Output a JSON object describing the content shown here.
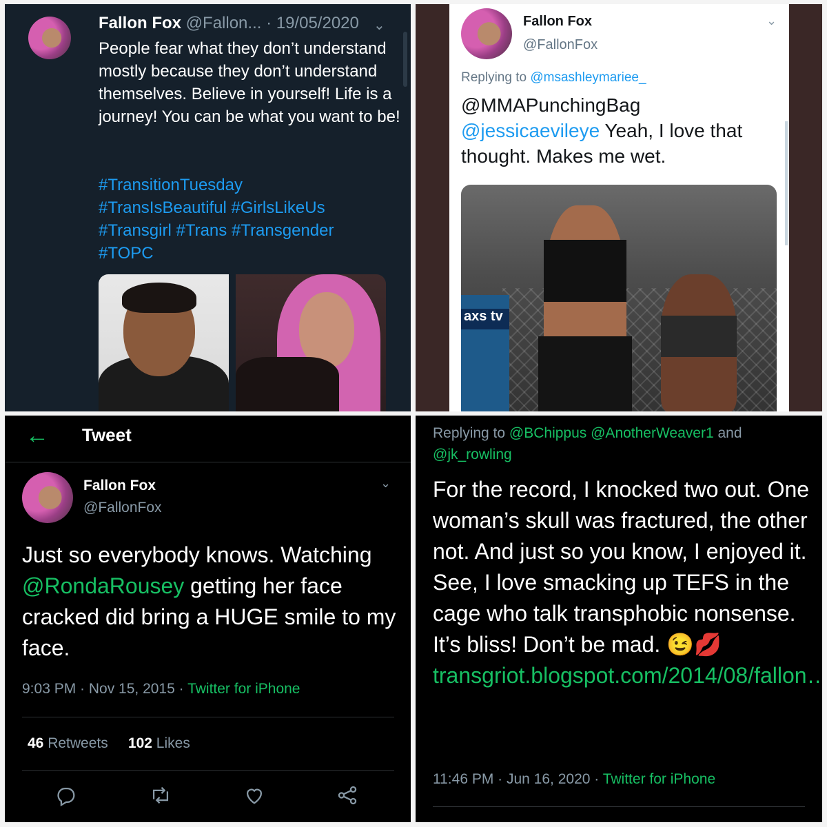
{
  "panel1": {
    "name": "Fallon Fox",
    "handle": "@Fallon...",
    "date": "· 19/05/2020",
    "body": "People fear what they don’t understand mostly because they don’t understand themselves. Believe in yourself! Life is a journey! You can be what you want to be!",
    "hashtags_line1": "#TransitionTuesday",
    "hashtags_line2": "#TransIsBeautiful #GirlsLikeUs",
    "hashtags_line3": "#Transgirl #Trans #Transgender",
    "hashtags_line4": "#TOPC",
    "icon": "chevron-down-icon"
  },
  "panel2": {
    "name": "Fallon Fox",
    "handle": "@FallonFox",
    "reply_prefix": "Replying to ",
    "reply_to": "@msashleymariee_",
    "mention1": "@MMAPunchingBag",
    "mention2": "@jessicaevileye",
    "body": " Yeah, I love that thought. Makes me wet.",
    "photo_sponsor": "axs tv"
  },
  "panel3": {
    "back_icon": "arrow-left-icon",
    "title": "Tweet",
    "name": "Fallon Fox",
    "handle": "@FallonFox",
    "text_a": "Just so everybody knows. Watching ",
    "mention": "@RondaRousey",
    "text_b": " getting her face cracked did bring a HUGE smile to my face.",
    "time": "9:03 PM · Nov 15, 2015 · ",
    "source": "Twitter for iPhone",
    "retweets": "46",
    "retweets_label": " Retweets",
    "likes": "102",
    "likes_label": " Likes",
    "actions": [
      "reply-icon",
      "retweet-icon",
      "like-icon",
      "share-icon"
    ]
  },
  "panel4": {
    "reply_prefix": "Replying to ",
    "reply_to": "@BChippus @AnotherWeaver1",
    "reply_and": " and",
    "reply_to2": "@jk_rowling",
    "body": "For the record, I knocked two out. One woman’s skull was fractured, the other not. And just so you know, I enjoyed it. See, I love smacking up TEFS in the cage who talk transphobic nonsense. It’s bliss! Don’t be mad. 😉💋",
    "link": "transgriot.blogspot.com/2014/08/fallon…",
    "time": "11:46 PM · Jun 16, 2020 · ",
    "source": "Twitter for iPhone"
  }
}
